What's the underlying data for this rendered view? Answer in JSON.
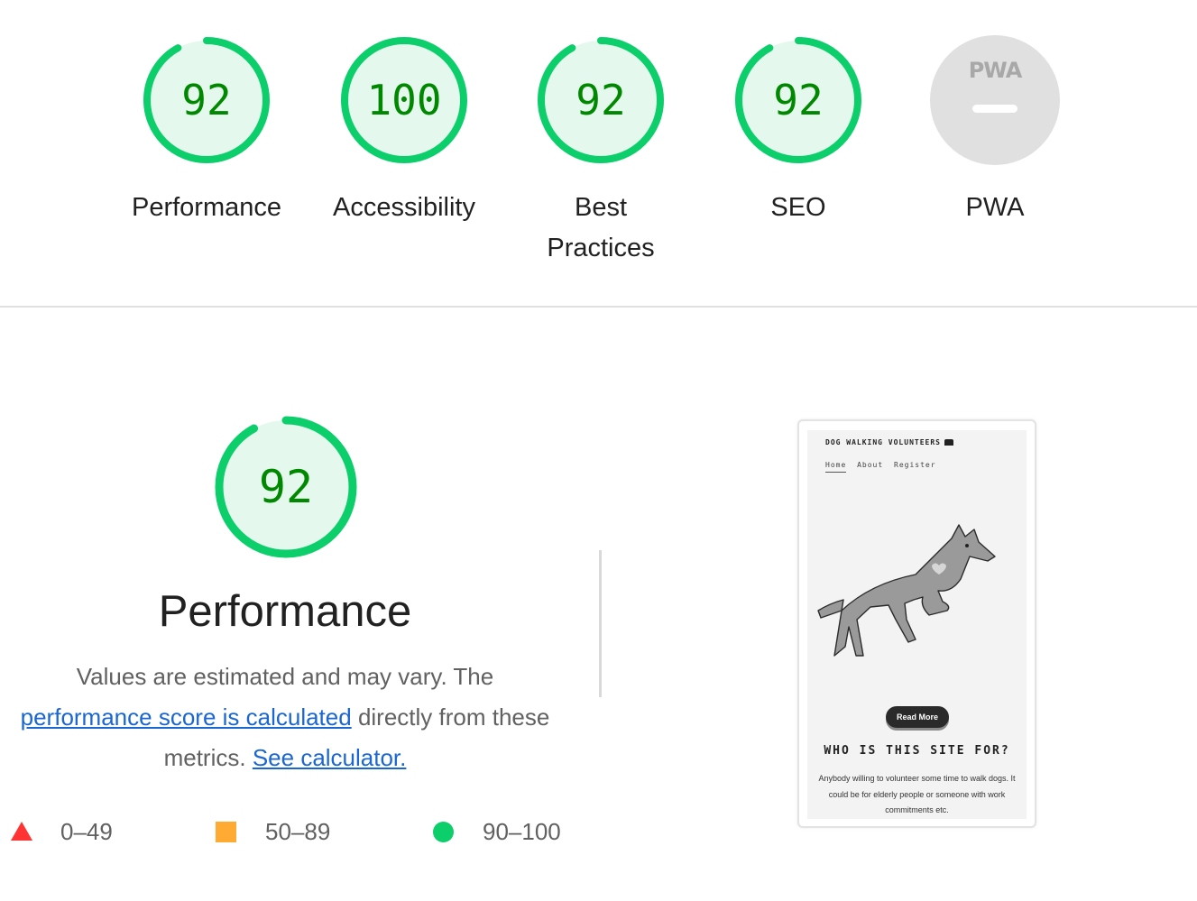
{
  "categories": [
    {
      "score": "92",
      "label": "Performance"
    },
    {
      "score": "100",
      "label": "Accessibility"
    },
    {
      "score": "92",
      "label": "Best Practices"
    },
    {
      "score": "92",
      "label": "SEO"
    },
    {
      "badge": "PWA",
      "label": "PWA"
    }
  ],
  "colors": {
    "pass": "#0cce6b",
    "pass_fill": "#e5f8ee",
    "score_text": "#008800",
    "average": "#ffaa33",
    "fail": "#ff3333",
    "link": "#1a66d2",
    "na": "#e0e0e0"
  },
  "performance": {
    "score": "92",
    "title": "Performance",
    "desc_before": "Values are estimated and may vary. The",
    "link_score": "performance score is calculated",
    "desc_middle": "directly from these metrics.",
    "link_calculator": "See calculator."
  },
  "legend": [
    {
      "icon": "triangle-icon",
      "range": "0–49"
    },
    {
      "icon": "square-icon",
      "range": "50–89"
    },
    {
      "icon": "circle-icon",
      "range": "90–100"
    }
  ],
  "screenshot": {
    "site_title": "DOG WALKING VOLUNTEERS",
    "nav": [
      "Home",
      "About",
      "Register"
    ],
    "button": "Read More",
    "heading": "WHO IS THIS SITE FOR?",
    "text": "Anybody willing to volunteer some time to walk dogs. It could be for elderly people or someone with work commitments etc."
  }
}
